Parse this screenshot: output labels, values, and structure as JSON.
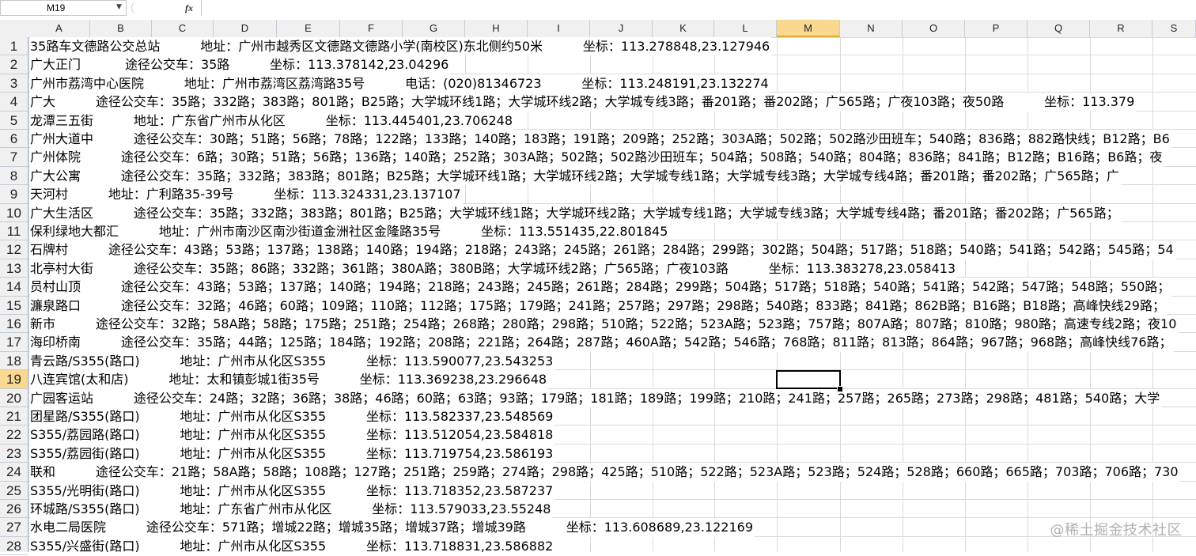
{
  "formula_bar": {
    "name_box": "M19",
    "fx_label": "fx",
    "formula": ""
  },
  "columns": [
    "A",
    "B",
    "C",
    "D",
    "E",
    "F",
    "G",
    "H",
    "I",
    "J",
    "K",
    "L",
    "M",
    "N",
    "O",
    "P",
    "Q",
    "R",
    "S"
  ],
  "selected_column": "M",
  "selected_row": 19,
  "rows": [
    {
      "n": "1",
      "text": "35路车文德路公交总站          地址：广州市越秀区文德路文德路小学(南校区)东北侧约50米          坐标：113.278848,23.127946"
    },
    {
      "n": "2",
      "text": "广大正门           途径公交车：35路          坐标：113.378142,23.04296"
    },
    {
      "n": "3",
      "text": "广州市荔湾中心医院          地址：广州市荔湾区荔湾路35号          电话：(020)81346723          坐标：113.248191,23.132274"
    },
    {
      "n": "4",
      "text": "广大          途径公交车：35路；332路；383路；801路；B25路；大学城环线1路；大学城环线2路；大学城专线3路；番201路；番202路；广565路；广夜103路；夜50路          坐标：113.379"
    },
    {
      "n": "5",
      "text": "龙潭三五街          地址：广东省广州市从化区          坐标：113.445401,23.706248"
    },
    {
      "n": "6",
      "text": "广州大道中          途径公交车：30路；51路；56路；78路；122路；133路；140路；183路；191路；209路；252路；303A路；502路；502路沙田班车；540路；836路；882路快线；B12路；B6"
    },
    {
      "n": "7",
      "text": "广州体院          途径公交车：6路；30路；51路；56路；136路；140路；252路；303A路；502路；502路沙田班车；504路；508路；540路；804路；836路；841路；B12路；B16路；B6路；夜"
    },
    {
      "n": "8",
      "text": "广大公寓          途径公交车：35路；332路；383路；801路；B25路；大学城环线1路；大学城环线2路；大学城专线1路；大学城专线3路；大学城专线4路；番201路；番202路；广565路；广"
    },
    {
      "n": "9",
      "text": "天河村          地址：广利路35-39号          坐标：113.324331,23.137107"
    },
    {
      "n": "10",
      "text": "广大生活区          途径公交车：35路；332路；383路；801路；B25路；大学城环线1路；大学城环线2路；大学城专线1路；大学城专线3路；大学城专线4路；番201路；番202路；广565路；"
    },
    {
      "n": "11",
      "text": "保利绿地大都汇          地址：广州市南沙区南沙街道金洲社区金隆路35号          坐标：113.551435,22.801845"
    },
    {
      "n": "12",
      "text": "石牌村          途径公交车：43路；53路；137路；138路；140路；194路；218路；243路；245路；261路；284路；299路；302路；504路；517路；518路；540路；541路；542路；545路；54"
    },
    {
      "n": "13",
      "text": "北亭村大街          途径公交车：35路；86路；332路；361路；380A路；380B路；大学城环线2路；广565路；广夜103路          坐标：113.383278,23.058413"
    },
    {
      "n": "14",
      "text": "员村山顶          途径公交车：43路；53路；137路；140路；194路；218路；243路；245路；261路；284路；299路；504路；517路；518路；540路；541路；542路；547路；548路；550路；"
    },
    {
      "n": "15",
      "text": "濂泉路口          途径公交车：32路；46路；60路；109路；110路；112路；175路；179路；241路；257路；297路；298路；540路；833路；841路；862B路；B16路；B18路；高峰快线29路；"
    },
    {
      "n": "16",
      "text": "新市          途径公交车：32路；58A路；58路；175路；251路；254路；268路；280路；298路；510路；522路；523A路；523路；757路；807A路；807路；810路；980路；高速专线2路；夜10"
    },
    {
      "n": "17",
      "text": "海印桥南          途径公交车：35路；44路；125路；184路；192路；208路；221路；264路；287路；460A路；542路；546路；768路；811路；813路；864路；967路；968路；高峰快线76路；"
    },
    {
      "n": "18",
      "text": "青云路/S355(路口)          地址：广州市从化区S355          坐标：113.590077,23.543253"
    },
    {
      "n": "19",
      "text": "八连宾馆(太和店)          地址：太和镇彭城1街35号          坐标：113.369238,23.296648"
    },
    {
      "n": "20",
      "text": "广园客运站          途径公交车：24路；32路；36路；38路；46路；60路；63路；93路；179路；181路；189路；199路；210路；241路；257路；265路；273路；298路；481路；540路；大学"
    },
    {
      "n": "21",
      "text": "团星路/S355(路口)          地址：广州市从化区S355          坐标：113.582337,23.548569"
    },
    {
      "n": "22",
      "text": "S355/荔园路(路口)          地址：广州市从化区S355          坐标：113.512054,23.584818"
    },
    {
      "n": "23",
      "text": "S355/荔园街(路口)          地址：广州市从化区S355          坐标：113.719754,23.586193"
    },
    {
      "n": "24",
      "text": "联和          途径公交车：21路；58A路；58路；108路；127路；251路；259路；274路；298路；425路；510路；522路；523A路；523路；524路；528路；660路；665路；703路；706路；730"
    },
    {
      "n": "25",
      "text": "S355/光明街(路口)          地址：广州市从化区S355          坐标：113.718352,23.587237"
    },
    {
      "n": "26",
      "text": "环城路/S355(路口)          地址：广东省广州市从化区          坐标：113.579033,23.55248"
    },
    {
      "n": "27",
      "text": "水电二局医院          途径公交车：571路；增城22路；增城35路；增城37路；增城39路          坐标：113.608689,23.122169"
    },
    {
      "n": "28",
      "text": "S355/兴盛街(路口)          地址：广州市从化区S355          坐标：113.718831,23.586882"
    }
  ],
  "watermark": "@稀土掘金技术社区"
}
